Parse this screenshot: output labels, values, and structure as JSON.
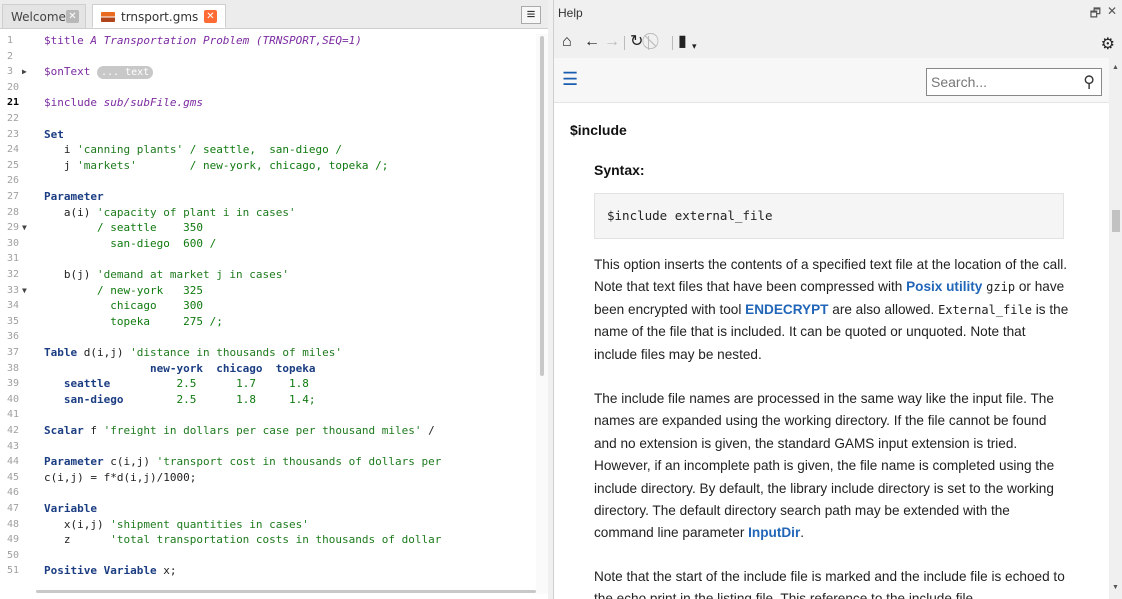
{
  "editor": {
    "tabs": [
      {
        "label": "Welcome",
        "active": false
      },
      {
        "label": "trnsport.gms",
        "active": true
      }
    ],
    "lines": [
      {
        "n": "1",
        "html": "<span class=\"dir\">$title <i>A Transportation Problem (TRNSPORT,SEQ=1)</i></span>"
      },
      {
        "n": "2",
        "html": ""
      },
      {
        "n": "3",
        "fold": "right",
        "html": "<span class=\"dir\">$onText</span> <span class=\"badge\">... text</span>"
      },
      {
        "n": "20",
        "html": ""
      },
      {
        "n": "21",
        "cur": true,
        "html": "<span class=\"dir\">$include <i>sub/subFile.gms</i></span>"
      },
      {
        "n": "22",
        "html": ""
      },
      {
        "n": "23",
        "html": "<span class=\"kw\">Set</span>"
      },
      {
        "n": "24",
        "html": "   i <span class=\"str\">'canning plants'</span> <span class=\"str2\">/ seattle,  san-diego /</span>"
      },
      {
        "n": "25",
        "html": "   j <span class=\"str\">'markets'</span>        <span class=\"str2\">/ new-york, chicago, topeka /;</span>"
      },
      {
        "n": "26",
        "html": ""
      },
      {
        "n": "27",
        "html": "<span class=\"kw\">Parameter</span>"
      },
      {
        "n": "28",
        "html": "   a(i) <span class=\"str\">'capacity of plant i in cases'</span>"
      },
      {
        "n": "29",
        "fold": "down",
        "html": "        <span class=\"str2\">/ seattle    350</span>"
      },
      {
        "n": "30",
        "html": "          <span class=\"str2\">san-diego  600 /</span>"
      },
      {
        "n": "31",
        "html": ""
      },
      {
        "n": "32",
        "html": "   b(j) <span class=\"str\">'demand at market j in cases'</span>"
      },
      {
        "n": "33",
        "fold": "down",
        "html": "        <span class=\"str2\">/ new-york   325</span>"
      },
      {
        "n": "34",
        "html": "          <span class=\"str2\">chicago    300</span>"
      },
      {
        "n": "35",
        "html": "          <span class=\"str2\">topeka     275 /;</span>"
      },
      {
        "n": "36",
        "html": ""
      },
      {
        "n": "37",
        "html": "<span class=\"kw\">Table</span> d(i,j) <span class=\"str\">'distance in thousands of miles'</span>"
      },
      {
        "n": "38",
        "html": "                <span class=\"kw\">new-york  chicago  topeka</span>"
      },
      {
        "n": "39",
        "html": "   <span class=\"kw\">seattle</span>          <span class=\"str2\">2.5      1.7     1.8</span>"
      },
      {
        "n": "40",
        "html": "   <span class=\"kw\">san-diego</span>        <span class=\"str2\">2.5      1.8     1.4;</span>"
      },
      {
        "n": "41",
        "html": ""
      },
      {
        "n": "42",
        "html": "<span class=\"kw\">Scalar</span> f <span class=\"str\">'freight in dollars per case per thousand miles'</span> /"
      },
      {
        "n": "43",
        "html": ""
      },
      {
        "n": "44",
        "html": "<span class=\"kw\">Parameter</span> c(i,j) <span class=\"str\">'transport cost in thousands of dollars per</span>"
      },
      {
        "n": "45",
        "html": "c(i,j) = f*d(i,j)/1000;"
      },
      {
        "n": "46",
        "html": ""
      },
      {
        "n": "47",
        "html": "<span class=\"kw\">Variable</span>"
      },
      {
        "n": "48",
        "html": "   x(i,j) <span class=\"str\">'shipment quantities in cases'</span>"
      },
      {
        "n": "49",
        "html": "   z      <span class=\"str\">'total transportation costs in thousands of dollar</span>"
      },
      {
        "n": "50",
        "html": ""
      },
      {
        "n": "51",
        "html": "<span class=\"kw\">Positive Variable</span> x;"
      }
    ]
  },
  "help": {
    "title": "Help",
    "search_placeholder": "Search...",
    "heading": "$include",
    "syntax_label": "Syntax:",
    "syntax_code": "$include external_file",
    "paragraphs": [
      "This option inserts the contents of a specified text file at the location of the call. Note that text files that have been compressed with <span class=\"lnk\">Posix utility</span> <span class=\"mono\">gzip</span> or have been encrypted with tool <span class=\"lnk\">ENDECRYPT</span> are also allowed. <span class=\"mono\">External_file</span> is the name of the file that is included. It can be quoted or unquoted. Note that include files may be nested.",
      "The include file names are processed in the same way like the input file. The names are expanded using the working directory. If the file cannot be found and no extension is given, the standard GAMS input extension is tried. However, if an incomplete path is given, the file name is completed using the include directory. By default, the library include directory is set to the working directory. The default directory search path may be extended with the command line parameter <span class=\"lnk\">InputDir</span>.",
      "Note that the start of the include file is marked and the include file is echoed to the echo print in the listing file. This reference to the include file"
    ]
  }
}
